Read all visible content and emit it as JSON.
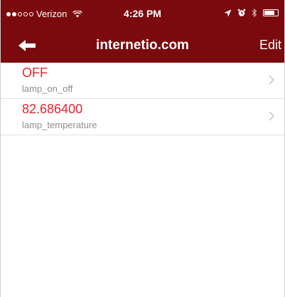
{
  "status_bar": {
    "carrier": "Verizon",
    "time": "4:26 PM",
    "signal_bars_filled": 2,
    "signal_bars_total": 5
  },
  "nav": {
    "title": "internetio.com",
    "edit_label": "Edit",
    "back_icon": "arrow-left-icon"
  },
  "items": [
    {
      "value": "OFF",
      "label": "lamp_on_off"
    },
    {
      "value": "82.686400",
      "label": "lamp_temperature"
    }
  ],
  "colors": {
    "header": "#7a0a0d",
    "value_text": "#e8232a",
    "label_text": "#8e8e8e"
  }
}
